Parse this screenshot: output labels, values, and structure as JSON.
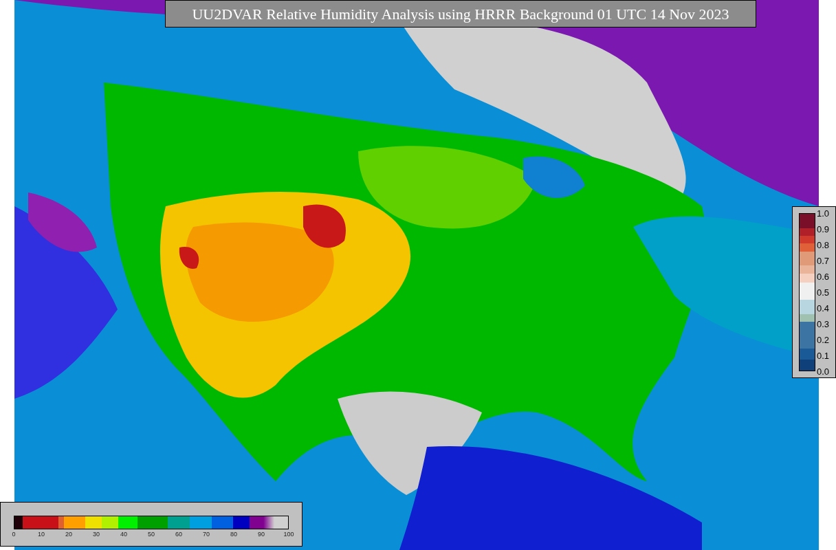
{
  "title": "UU2DVAR Relative Humidity Analysis using HRRR Background 01 UTC 14 Nov 2023",
  "station_legend": {
    "ticks": [
      "1.0",
      "0.9",
      "0.8",
      "0.7",
      "0.6",
      "0.5",
      "0.4",
      "0.3",
      "0.2",
      "0.1",
      "0.0"
    ]
  },
  "humidity_legend": {
    "ticks": [
      "0",
      "10",
      "20",
      "30",
      "40",
      "50",
      "60",
      "70",
      "80",
      "90",
      "100"
    ]
  }
}
